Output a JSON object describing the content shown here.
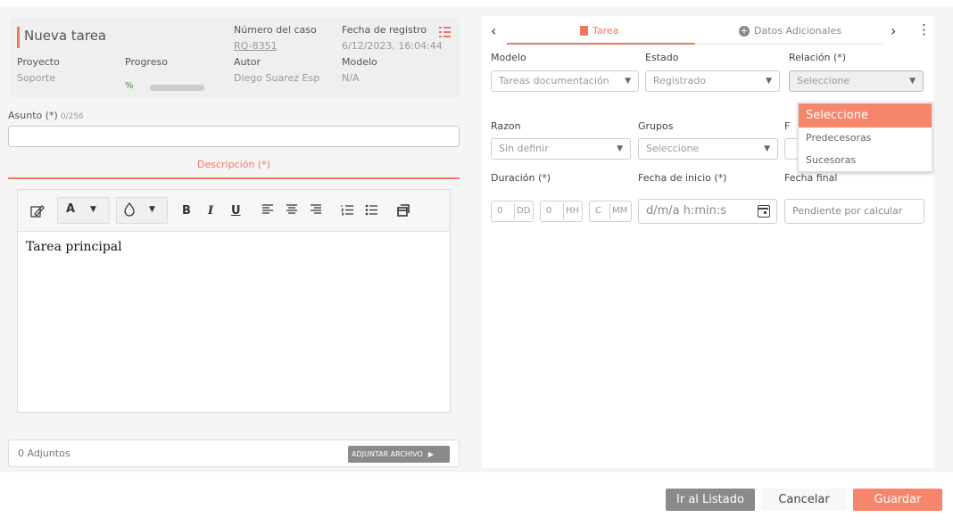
{
  "task": {
    "title": "Nueva tarea",
    "case_number_label": "Número del caso",
    "case_number": "RQ-8351",
    "registration_date_label": "Fecha de registro",
    "registration_date": "6/12/2023, 16:04:44",
    "project_label": "Proyecto",
    "project": "Soporte",
    "progress_label": "Progreso",
    "progress_value": "%",
    "progress_fraction": 0,
    "author_label": "Autor",
    "author": "Diego Suarez Esp",
    "model_label": "Modelo",
    "model": "N/A"
  },
  "subject": {
    "label": "Asunto (*)",
    "counter": "0/256",
    "value": ""
  },
  "description": {
    "tab_label": "Descripción (*)",
    "content": "Tarea principal"
  },
  "toolbar": {
    "font_color_label": "A",
    "bold": "B",
    "italic": "I",
    "underline": "U"
  },
  "attachments": {
    "count_label": "0 Adjuntos",
    "button_label": "ADJUNTAR ARCHIVO"
  },
  "tabs": [
    {
      "label": "Tarea",
      "active": true
    },
    {
      "label": "Datos Adicionales",
      "active": false
    }
  ],
  "form": {
    "model_label": "Modelo",
    "model_value": "Tareas documentación",
    "state_label": "Estado",
    "state_value": "Registrado",
    "relation_label": "Relación (*)",
    "relation_value": "Seleccione",
    "reason_label": "Razon",
    "reason_value": "Sin definir",
    "groups_label": "Grupos",
    "groups_value": "Seleccione",
    "hidden_label_initial": "F",
    "duration_label": "Duración (*)",
    "duration_days": "0",
    "duration_days_unit": "DD",
    "duration_hours": "0",
    "duration_hours_unit": "HH",
    "duration_minutes": "C",
    "duration_minutes_unit": "MM",
    "start_date_label": "Fecha de inicio (*)",
    "start_date_placeholder": "d/m/a h:min:s",
    "end_date_label": "Fecha final",
    "end_date_value": "Pendiente por calcular"
  },
  "relation_dropdown": {
    "options": [
      "Seleccione",
      "Predecesoras",
      "Sucesoras"
    ],
    "selected": "Seleccione"
  },
  "buttons": {
    "list": "Ir al Listado",
    "cancel": "Cancelar",
    "save": "Guardar"
  },
  "colors": {
    "accent": "#f5866c",
    "progress": "#3a9a3a",
    "neutral_button": "#8a8a8a"
  }
}
